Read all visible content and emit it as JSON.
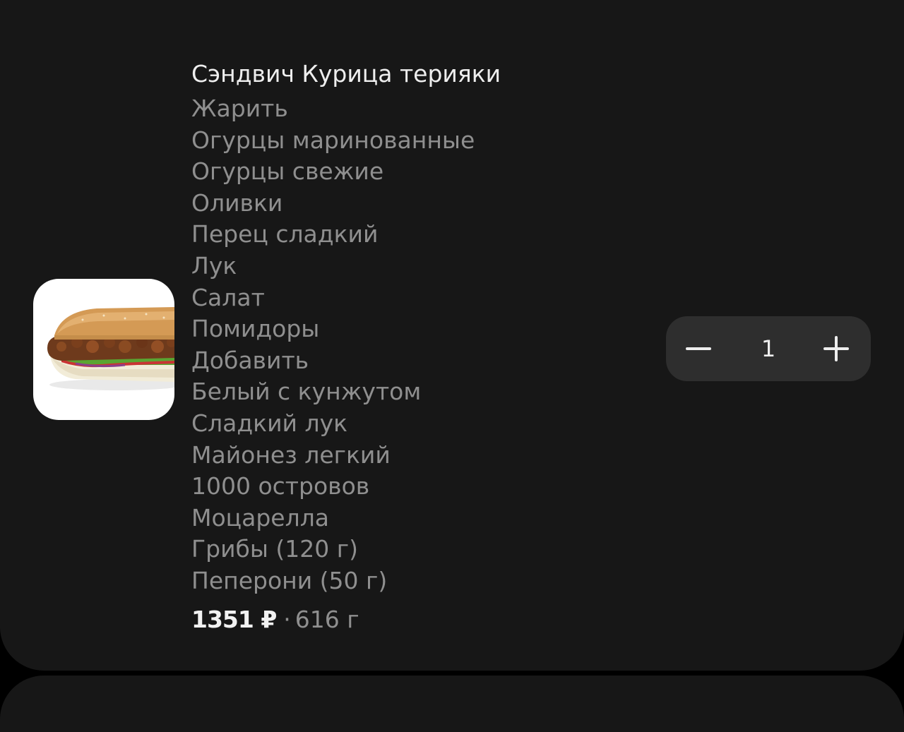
{
  "item": {
    "title": "Сэндвич Курица терияки",
    "modifiers": [
      "Жарить",
      "Огурцы маринованные",
      "Огурцы свежие",
      "Оливки",
      "Перец сладкий",
      "Лук",
      "Салат",
      "Помидоры",
      "Добавить",
      "Белый с кунжутом",
      "Сладкий лук",
      "Майонез легкий",
      "1000 островов",
      "Моцарелла",
      "Грибы (120 г)",
      "Пеперони (50 г)"
    ],
    "price": "1351 ₽",
    "separator": "·",
    "weight": "616 г"
  },
  "stepper": {
    "quantity": "1"
  },
  "colors": {
    "background": "#000000",
    "card": "#171717",
    "stepper": "#2e2e2e",
    "primary_text": "#eeeeee",
    "secondary_text": "#8f8f8f"
  }
}
